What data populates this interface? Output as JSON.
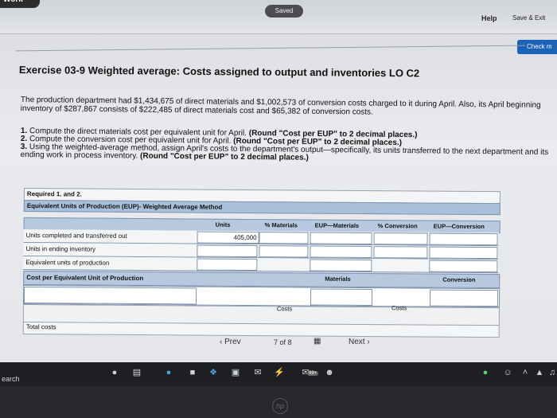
{
  "app": {
    "logo_text": "Work",
    "saved_label": "Saved",
    "help_label": "Help",
    "save_exit_label": "Save & Exit",
    "check_label": "Check m"
  },
  "exercise": {
    "title": "Exercise 03-9 Weighted average: Costs assigned to output and inventories LO C2",
    "paragraph": "The production department had $1,434,675 of direct materials and $1,002,573 of conversion costs charged to it during April. Also, its April beginning inventory of $287,867 consists of $222,485 of direct materials cost and $65,382 of conversion costs.",
    "items": [
      {
        "num": "1.",
        "text": "Compute the direct materials cost per equivalent unit for April. ",
        "bold": "(Round \"Cost per EUP\" to 2 decimal places.)"
      },
      {
        "num": "2.",
        "text": "Compute the conversion cost per equivalent unit for April. ",
        "bold": "(Round \"Cost per EUP\" to 2 decimal places.)"
      },
      {
        "num": "3.",
        "text": "Using the weighted-average method, assign April's costs to the department's output—specifically, its units transferred to the next department and its ending work in process inventory. ",
        "bold": "(Round \"Cost per EUP\" to 2 decimal places.)"
      }
    ]
  },
  "table": {
    "required_label": "Required 1. and 2.",
    "section_header": "Equivalent Units of Production (EUP)- Weighted Average Method",
    "columns": [
      "Units",
      "% Materials",
      "EUP—Materials",
      "% Conversion",
      "EUP—Conversion"
    ],
    "rows": [
      {
        "label": "Units completed and transferred out",
        "units": "405,000"
      },
      {
        "label": "Units in ending inventory",
        "units": ""
      },
      {
        "label": "Equivalent units of production",
        "units": ""
      }
    ],
    "cost_row_label": "Cost per Equivalent Unit of Production",
    "materials_label": "Materials",
    "conversion_label": "Conversion",
    "costs_label_1": "Costs",
    "costs_label_2": "Costs",
    "total_costs_label": "Total costs"
  },
  "nav": {
    "prev_label": "Prev",
    "page_current": "7",
    "page_of": "of",
    "page_total": "8",
    "next_label": "Next"
  },
  "taskbar": {
    "search_text": "earch",
    "badge": "99+"
  },
  "device": {
    "logo_text": "hp"
  }
}
